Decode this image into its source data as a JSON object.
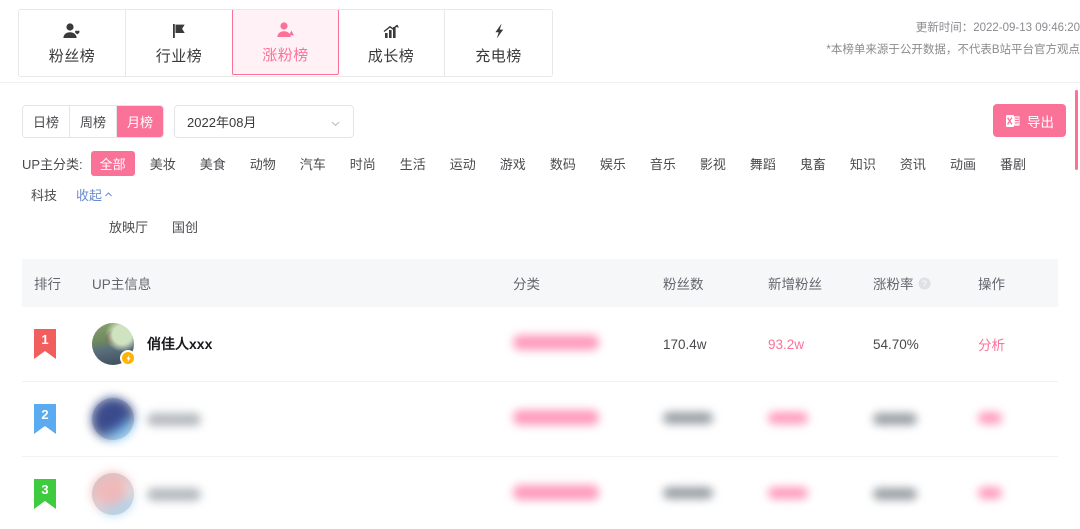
{
  "header": {
    "tabs": [
      {
        "label": "粉丝榜",
        "icon": "user-heart-icon",
        "active": false
      },
      {
        "label": "行业榜",
        "icon": "flag-icon",
        "active": false
      },
      {
        "label": "涨粉榜",
        "icon": "user-up-icon",
        "active": true
      },
      {
        "label": "成长榜",
        "icon": "growth-chart-icon",
        "active": false
      },
      {
        "label": "充电榜",
        "icon": "lightning-icon",
        "active": false
      }
    ],
    "update_time": "更新时间：2022-09-13 09:46:20",
    "disclaimer": "*本榜单来源于公开数据，不代表B站平台官方观点"
  },
  "filters": {
    "period_options": [
      "日榜",
      "周榜",
      "月榜"
    ],
    "period_selected": "月榜",
    "date_value": "2022年08月",
    "export_label": "导出",
    "export_icon": "excel-icon",
    "category_label": "UP主分类:",
    "categories_row1": [
      "全部",
      "美妆",
      "美食",
      "动物",
      "汽车",
      "时尚",
      "生活",
      "运动",
      "游戏",
      "数码",
      "娱乐",
      "音乐",
      "影视",
      "舞蹈",
      "鬼畜",
      "知识",
      "资讯",
      "动画",
      "番剧",
      "科技"
    ],
    "categories_row2": [
      "放映厅",
      "国创"
    ],
    "category_selected": "全部",
    "collapse_label": "收起"
  },
  "table": {
    "columns": {
      "rank": "排行",
      "up": "UP主信息",
      "category": "分类",
      "fans": "粉丝数",
      "new_fans": "新增粉丝",
      "rate": "涨粉率",
      "action": "操作"
    },
    "rate_help_icon": "question-circle-icon",
    "rows": [
      {
        "rank": "1",
        "rank_color": "#f25d5d",
        "name": "俏佳人xxx",
        "name_redacted": false,
        "avatar_badge": "lightning-badge-icon",
        "category": "",
        "category_redacted": true,
        "fans": "170.4w",
        "fans_redacted": false,
        "new_fans": "93.2w",
        "new_fans_redacted": false,
        "rate": "54.70%",
        "rate_redacted": false,
        "action": "分析",
        "action_redacted": false
      },
      {
        "rank": "2",
        "rank_color": "#5aabf0",
        "name": "",
        "name_redacted": true,
        "avatar_badge": "",
        "category": "",
        "category_redacted": true,
        "fans": "",
        "fans_redacted": true,
        "new_fans": "",
        "new_fans_redacted": true,
        "rate": "",
        "rate_redacted": true,
        "action": "",
        "action_redacted": true
      },
      {
        "rank": "3",
        "rank_color": "#3fcb3f",
        "name": "",
        "name_redacted": true,
        "avatar_badge": "",
        "category": "",
        "category_redacted": true,
        "fans": "",
        "fans_redacted": true,
        "new_fans": "",
        "new_fans_redacted": true,
        "rate": "",
        "rate_redacted": true,
        "action": "",
        "action_redacted": true
      }
    ]
  },
  "colors": {
    "brand_pink": "#fb7299",
    "active_tab_bg": "#fff1f5",
    "header_bg": "#f6f7f8",
    "new_fans_text": "#fb7299"
  }
}
